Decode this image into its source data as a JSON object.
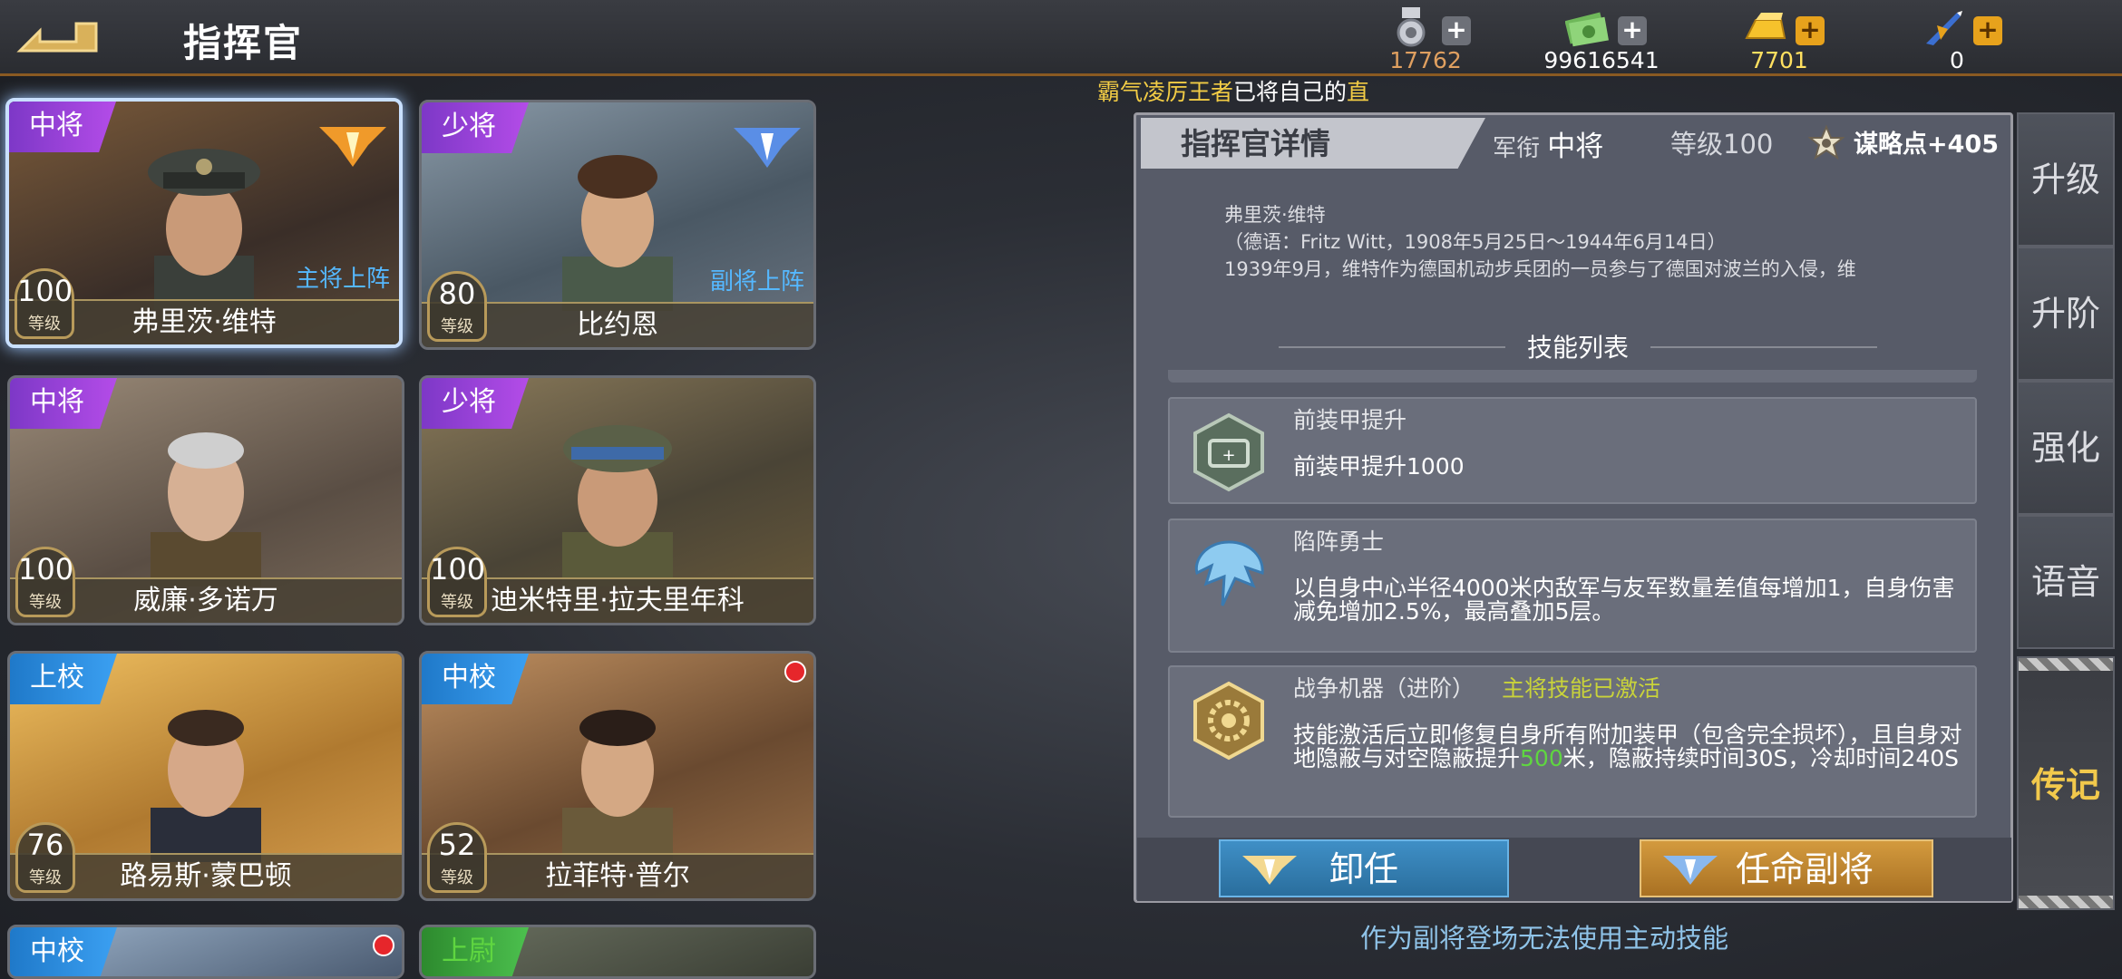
{
  "header": {
    "title": "指挥官"
  },
  "resources": [
    {
      "icon": "medal-icon",
      "value": "17762",
      "color": "#e0a060"
    },
    {
      "icon": "cash-icon",
      "value": "99616541",
      "color": "#ffffff"
    },
    {
      "icon": "gold-bar-icon",
      "value": "7701",
      "color": "#ffe060"
    },
    {
      "icon": "fighter-jet-icon",
      "value": "0",
      "color": "#ffffff"
    }
  ],
  "ticker": {
    "highlight": "霸气凌厉王者",
    "mid": "已将自己的",
    "tail": "直"
  },
  "commanders": [
    {
      "rank": "中将",
      "name": "弗里茨·维特",
      "level": "100",
      "level_label": "等级",
      "role": "主将上阵",
      "rank_color": "purple"
    },
    {
      "rank": "少将",
      "name": "比约恩",
      "level": "80",
      "level_label": "等级",
      "role": "副将上阵",
      "rank_color": "purple"
    },
    {
      "rank": "中将",
      "name": "威廉·多诺万",
      "level": "100",
      "level_label": "等级",
      "rank_color": "purple"
    },
    {
      "rank": "少将",
      "name": "迪米特里·拉夫里年科",
      "level": "100",
      "level_label": "等级",
      "rank_color": "purple"
    },
    {
      "rank": "上校",
      "name": "路易斯·蒙巴顿",
      "level": "76",
      "level_label": "等级",
      "rank_color": "blue"
    },
    {
      "rank": "中校",
      "name": "拉菲特·普尔",
      "level": "52",
      "level_label": "等级",
      "rank_color": "blue"
    },
    {
      "rank": "中校",
      "rank_color": "blue"
    },
    {
      "rank": "上尉",
      "rank_color": "green"
    }
  ],
  "detail": {
    "title": "指挥官详情",
    "rank_label": "军衔",
    "rank_value": "中将",
    "level_text": "等级100",
    "strategy_text": "谋略点+405",
    "bio_name": "弗里茨·维特",
    "bio_line1": "（德语：Fritz Witt，1908年5月25日～1944年6月14日）",
    "bio_line2": "1939年9月，维特作为德国机动步兵团的一员参与了德国对波兰的入侵，维",
    "skills_title": "技能列表",
    "skills": [
      {
        "icon": "armor-shield-icon",
        "name": "前装甲提升",
        "desc": "前装甲提升1000"
      },
      {
        "icon": "dragon-icon",
        "name": "陷阵勇士",
        "desc": "以自身中心半径4000米内敌军与友军数量差值每增加1，自身伤害减免增加2.5%，最高叠加5层。"
      },
      {
        "icon": "gear-icon",
        "name": "战争机器（进阶）",
        "status": "主将技能已激活",
        "desc_a": "技能激活后立即修复自身所有附加装甲（包含完全损坏），且自身对地隐蔽与对空隐蔽提升",
        "desc_green": "500",
        "desc_b": "米，隐蔽持续时间30S，冷却时间240S"
      }
    ],
    "btn_dismiss": "卸任",
    "btn_appoint": "任命副将",
    "note": "作为副将登场无法使用主动技能"
  },
  "side_tabs": [
    "升级",
    "升阶",
    "强化",
    "语音",
    "传记"
  ]
}
